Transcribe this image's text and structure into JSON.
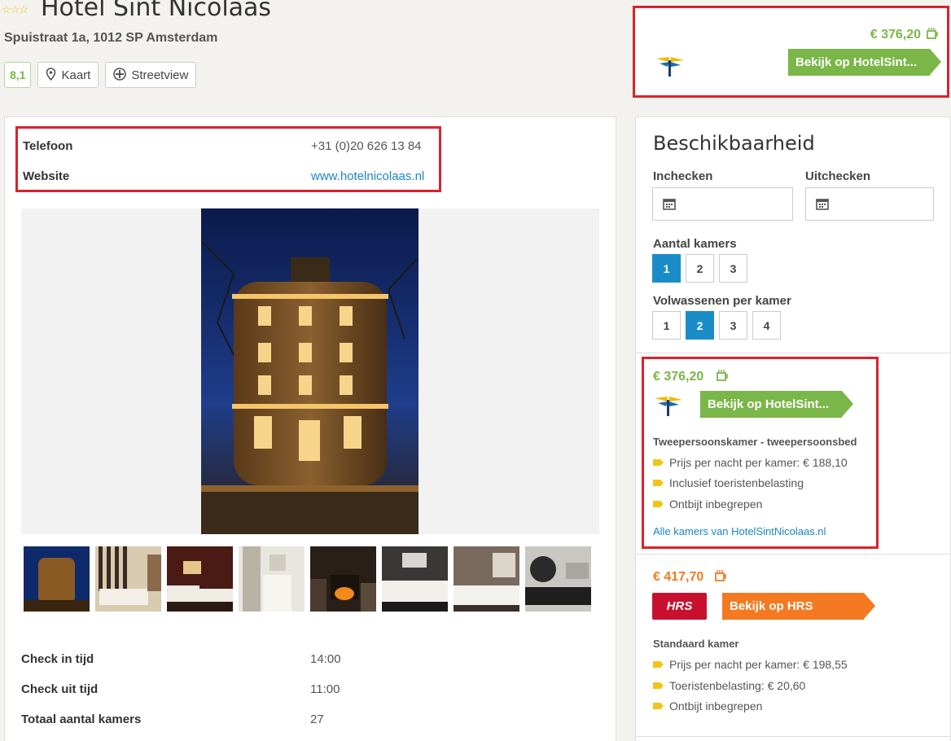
{
  "header": {
    "stars": "☆☆☆",
    "hotel_name": "Hotel Sint Nicolaas",
    "address": "Spuistraat 1a, 1012 SP Amsterdam",
    "score": "8,1",
    "map_label": "Kaart",
    "streetview_label": "Streetview"
  },
  "top_deal": {
    "price": "€ 376,20",
    "button": "Bekijk op HotelSint..."
  },
  "contact": {
    "phone_label": "Telefoon",
    "phone_value": "+31 (0)20 626 13 84",
    "website_label": "Website",
    "website_value": "www.hotelnicolaas.nl"
  },
  "facts": [
    {
      "label": "Check in tijd",
      "value": "14:00"
    },
    {
      "label": "Check uit tijd",
      "value": "11:00"
    },
    {
      "label": "Totaal aantal kamers",
      "value": "27"
    }
  ],
  "availability": {
    "title": "Beschikbaarheid",
    "checkin_label": "Inchecken",
    "checkout_label": "Uitchecken",
    "rooms_label": "Aantal kamers",
    "rooms_options": [
      "1",
      "2",
      "3"
    ],
    "rooms_selected": "1",
    "adults_label": "Volwassenen per kamer",
    "adults_options": [
      "1",
      "2",
      "3",
      "4"
    ],
    "adults_selected": "2"
  },
  "deals": [
    {
      "price": "€ 376,20",
      "price_color": "#7ab648",
      "button": "Bekijk op HotelSint...",
      "room_type": "Tweepersoonskamer - tweepersoonsbed",
      "bullets": [
        "Prijs per nacht per kamer: € 188,10",
        "Inclusief toeristenbelasting",
        "Ontbijt inbegrepen"
      ],
      "all_rooms_link": "Alle kamers van HotelSintNicolaas.nl"
    },
    {
      "price": "€ 417,70",
      "price_color": "#f47921",
      "provider_logo": "HRS",
      "button": "Bekijk op HRS",
      "room_type": "Standaard kamer",
      "bullets": [
        "Prijs per nacht per kamer: € 198,55",
        "Toeristenbelasting: € 20,60",
        "Ontbijt inbegrepen"
      ]
    }
  ],
  "colors": {
    "highlight_border": "#d9232d",
    "green": "#7ab648",
    "orange": "#f47921",
    "blue": "#1a8dc8"
  }
}
